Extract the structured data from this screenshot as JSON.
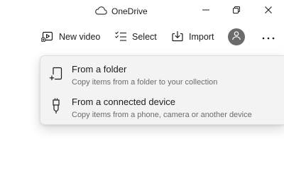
{
  "window": {
    "title": "OneDrive"
  },
  "window_controls": {
    "minimize": "minimize-icon",
    "maximize": "restore-icon",
    "close": "close-icon"
  },
  "toolbar": {
    "new_video_label": "New video",
    "select_label": "Select",
    "import_label": "Import",
    "more_icon": "ellipsis-icon",
    "account_icon": "person-icon"
  },
  "import_menu": {
    "items": [
      {
        "label": "From a folder",
        "description": "Copy items from a folder to your collection",
        "icon": "folder-add-icon"
      },
      {
        "label": "From a connected device",
        "description": "Copy items from a phone, camera or another device",
        "icon": "usb-device-icon"
      }
    ]
  },
  "colors": {
    "menu_background": "#f3f3f3",
    "avatar": "#6b6b6b",
    "secondary_text": "#6b6b6b"
  }
}
